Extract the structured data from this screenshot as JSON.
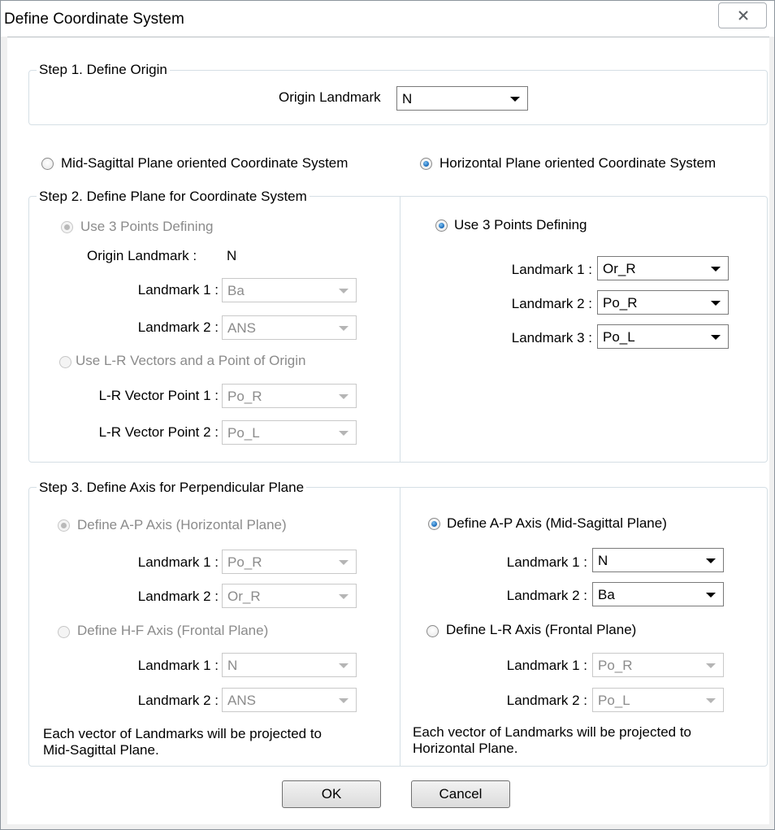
{
  "window": {
    "title": "Define Coordinate System"
  },
  "step1": {
    "legend": "Step 1. Define Origin",
    "origin_label": "Origin Landmark",
    "origin_value": "N"
  },
  "modes": {
    "mid_sagittal": "Mid-Sagittal Plane oriented Coordinate System",
    "horizontal": "Horizontal Plane oriented Coordinate System",
    "selected": "horizontal"
  },
  "step2": {
    "legend": "Step 2. Define Plane for Coordinate System",
    "left": {
      "use3_label": "Use 3 Points Defining",
      "origin_label": "Origin Landmark :",
      "origin_value": "N",
      "lm1_label": "Landmark 1 :",
      "lm1_value": "Ba",
      "lm2_label": "Landmark 2 :",
      "lm2_value": "ANS",
      "lr_label": "Use L-R Vectors and a Point of Origin",
      "lr1_label": "L-R Vector Point 1 :",
      "lr1_value": "Po_R",
      "lr2_label": "L-R Vector Point 2 :",
      "lr2_value": "Po_L"
    },
    "right": {
      "use3_label": "Use 3 Points Defining",
      "lm1_label": "Landmark 1 :",
      "lm1_value": "Or_R",
      "lm2_label": "Landmark 2 :",
      "lm2_value": "Po_R",
      "lm3_label": "Landmark 3 :",
      "lm3_value": "Po_L"
    }
  },
  "step3": {
    "legend": "Step 3. Define Axis for Perpendicular Plane",
    "left": {
      "ap_label": "Define A-P Axis (Horizontal Plane)",
      "ap_lm1_label": "Landmark 1 :",
      "ap_lm1_value": "Po_R",
      "ap_lm2_label": "Landmark 2 :",
      "ap_lm2_value": "Or_R",
      "hf_label": "Define H-F Axis (Frontal Plane)",
      "hf_lm1_label": "Landmark 1 :",
      "hf_lm1_value": "N",
      "hf_lm2_label": "Landmark 2 :",
      "hf_lm2_value": "ANS",
      "note_line1": "Each vector of Landmarks will be projected to",
      "note_line2": "Mid-Sagittal Plane."
    },
    "right": {
      "ap_label": "Define A-P Axis (Mid-Sagittal Plane)",
      "ap_lm1_label": "Landmark 1 :",
      "ap_lm1_value": "N",
      "ap_lm2_label": "Landmark 2 :",
      "ap_lm2_value": "Ba",
      "lr_label": "Define L-R Axis (Frontal Plane)",
      "lr_lm1_label": "Landmark 1 :",
      "lr_lm1_value": "Po_R",
      "lr_lm2_label": "Landmark 2 :",
      "lr_lm2_value": "Po_L",
      "note_line1": "Each vector of Landmarks will be projected to",
      "note_line2": "Horizontal Plane."
    }
  },
  "buttons": {
    "ok": "OK",
    "cancel": "Cancel"
  },
  "icons": {
    "close": "close-icon",
    "dropdown": "chevron-down-icon"
  }
}
